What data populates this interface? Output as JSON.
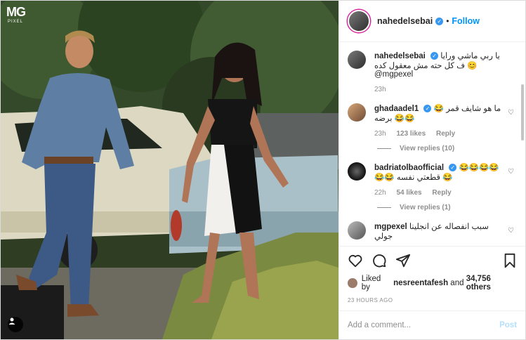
{
  "photo": {
    "logo_big": "MG",
    "logo_small": "PIXEL",
    "tag_icon": "user-tag-icon"
  },
  "header": {
    "username": "nahedelsebai",
    "verified_icon": "verified-badge-icon",
    "separator": "•",
    "follow_label": "Follow"
  },
  "caption": {
    "username": "nahedelsebai",
    "text": "يا ربي ماشي ورايا ف كل حته مش معقول كده 😊 @mgpexel",
    "time": "23h"
  },
  "comments": [
    {
      "username": "ghadaadel1",
      "text": "ما هو شايف قمر 😂😂😂 برضه",
      "time": "23h",
      "likes": "123 likes",
      "reply_label": "Reply",
      "view_replies": "View replies (10)"
    },
    {
      "username": "badriatolbaofficial",
      "text": "😂😂😂😂😂😂 قطعتي نفسه 😂",
      "time": "22h",
      "likes": "54 likes",
      "reply_label": "Reply",
      "view_replies": "View replies (1)"
    },
    {
      "username": "mgpexel",
      "text": "سبب انفصاله عن انجلينا جولي"
    }
  ],
  "actions": {
    "like_icon": "heart-icon",
    "comment_icon": "comment-icon",
    "share_icon": "share-icon",
    "save_icon": "bookmark-icon"
  },
  "likes": {
    "prefix": "Liked by ",
    "user": "nesreentafesh",
    "middle": " and ",
    "count": "34,756 others"
  },
  "timestamp": "23 HOURS AGO",
  "add_comment": {
    "placeholder": "Add a comment...",
    "post_label": "Post"
  },
  "colors": {
    "accent": "#0095f6",
    "verified": "#3897f0",
    "muted": "#8e8e8e",
    "post_disabled": "#b2dffc"
  }
}
